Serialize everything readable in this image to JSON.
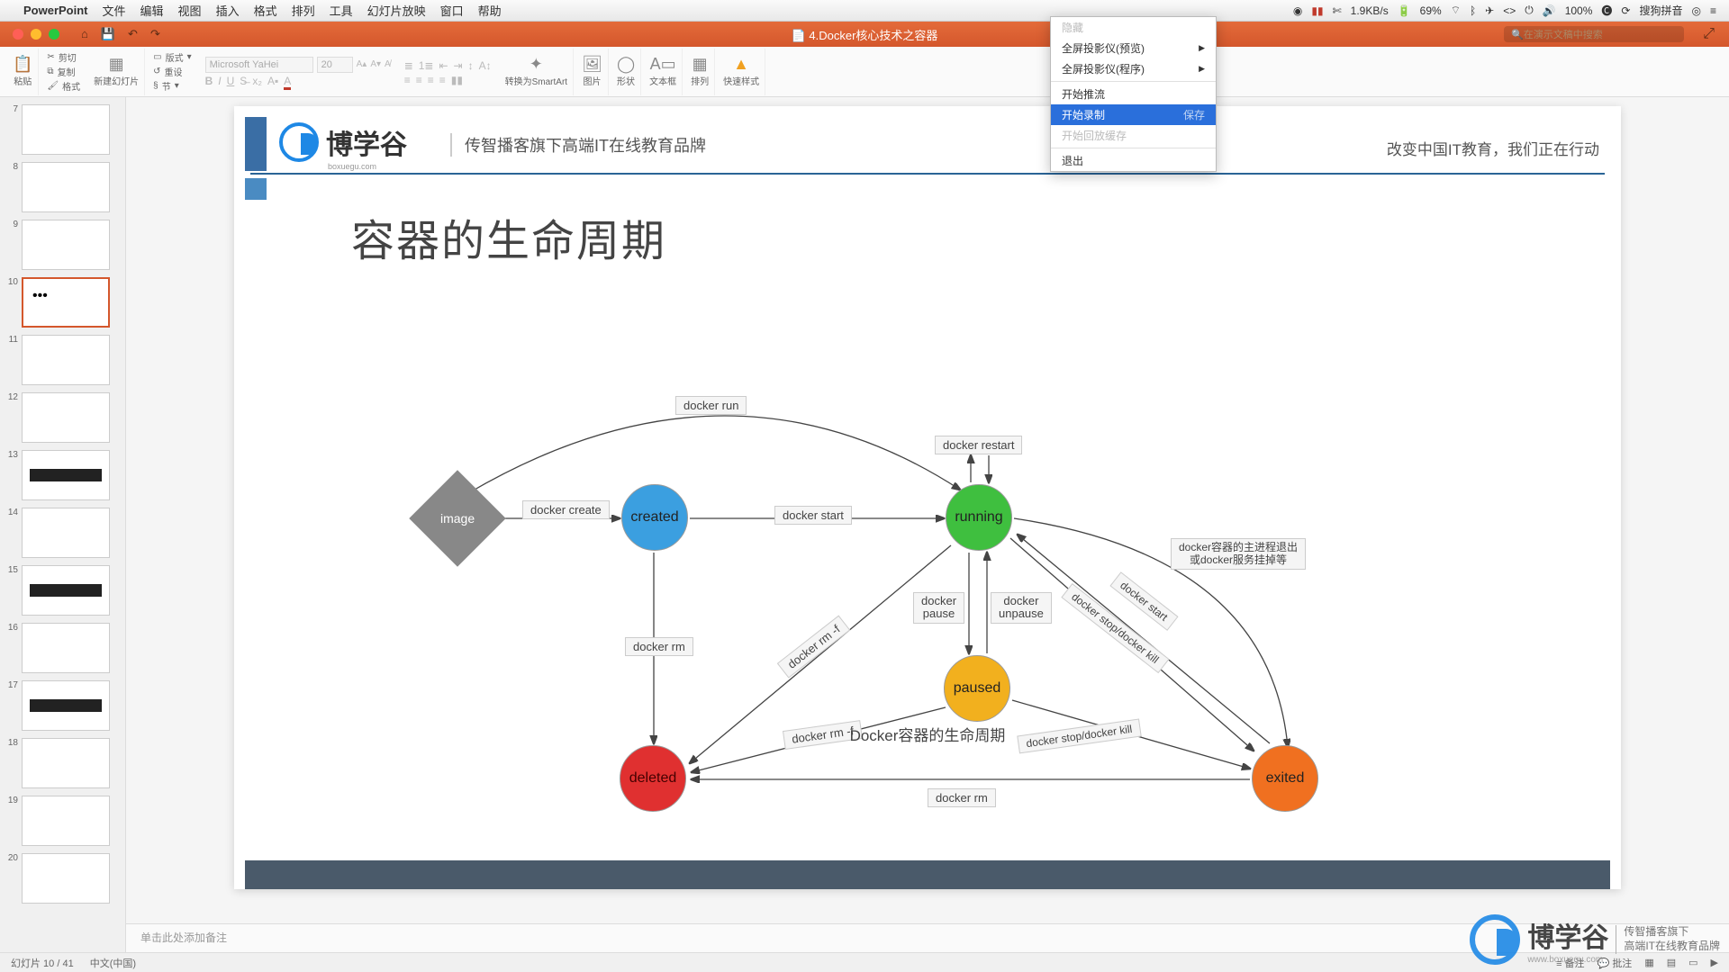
{
  "menubar": {
    "app": "PowerPoint",
    "items": [
      "文件",
      "编辑",
      "视图",
      "插入",
      "格式",
      "排列",
      "工具",
      "幻灯片放映",
      "窗口",
      "帮助"
    ],
    "status": {
      "net": "1.9KB/s",
      "batt": "69%",
      "sound": "100%",
      "ime": "搜狗拼音",
      "clock": ""
    }
  },
  "titlebar": {
    "doc": "4.Docker核心技术之容器",
    "search_ph": "在演示文稿中搜索"
  },
  "dropdown": {
    "items": [
      {
        "label": "隐藏",
        "disabled": true
      },
      {
        "label": "全屏投影仪(预览)",
        "sub": true
      },
      {
        "label": "全屏投影仪(程序)",
        "sub": true
      },
      {
        "label": "开始推流"
      },
      {
        "label": "开始录制",
        "hl": true,
        "extra": "保存"
      },
      {
        "label": "开始回放缓存",
        "disabled": true
      },
      {
        "label": "退出"
      }
    ]
  },
  "ribbon": {
    "paste": "粘贴",
    "cut": "剪切",
    "copy": "复制",
    "format": "格式",
    "newslide": "新建幻灯片",
    "layout": "版式",
    "reset": "重设",
    "section": "节",
    "font": "Microsoft YaHei",
    "size": "20",
    "convert": "转换为SmartArt",
    "picture": "图片",
    "shapes": "形状",
    "textbox": "文本框",
    "arrange": "排列",
    "quick": "快速样式"
  },
  "thumbs": {
    "start": 7,
    "count": 14,
    "active": 10
  },
  "slide": {
    "brand": "博学谷",
    "brand_sub": "boxuegu.com",
    "tagline": "传智播客旗下高端IT在线教育品牌",
    "slogan": "改变中国IT教育，我们正在行动",
    "title": "容器的生命周期",
    "caption": "Docker容器的生命周期",
    "nodes": {
      "image": "image",
      "created": "created",
      "running": "running",
      "paused": "paused",
      "deleted": "deleted",
      "exited": "exited"
    },
    "edges": {
      "run": "docker run",
      "create": "docker create",
      "start": "docker start",
      "restart": "docker restart",
      "rm": "docker rm",
      "rmf": "docker rm -f",
      "pause": "docker pause",
      "unpause": "docker unpause",
      "stopkill": "docker stop/docker kill",
      "start2": "docker start",
      "note": "docker容器的主进程退出\n或docker服务挂掉等"
    }
  },
  "notes": "单击此处添加备注",
  "status": {
    "slide": "幻灯片 10 / 41",
    "lang": "中文(中国)",
    "notes": "备注",
    "comments": "批注"
  },
  "watermark": {
    "name": "博学谷",
    "line1": "传智播客旗下",
    "line2": "高端IT在线教育品牌",
    "url": "www.boxuegu.com"
  }
}
